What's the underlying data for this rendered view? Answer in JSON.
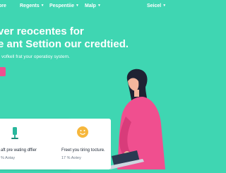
{
  "nav": {
    "items": [
      {
        "label": "ore"
      },
      {
        "label": "Regents"
      },
      {
        "label": "Pespentiie"
      },
      {
        "label": "Malp"
      },
      {
        "label": "Seicel"
      }
    ]
  },
  "hero": {
    "title_line1": "ver reocentes for",
    "title_line2": "e ant Settion our credtied.",
    "subtitle": "vofkell frat your operatioy system."
  },
  "cards": [
    {
      "title": "aft pre wating dffier",
      "meta": "% Aotay",
      "icon": "stand-icon"
    },
    {
      "title": "Freet you tiring tocture.",
      "meta": "17 % Aotey",
      "icon": "smiley-icon"
    }
  ],
  "colors": {
    "background": "#3fd6b2",
    "cta": "#f04f8f",
    "icon_teal": "#29b79c",
    "icon_yellow": "#f6b73c"
  }
}
